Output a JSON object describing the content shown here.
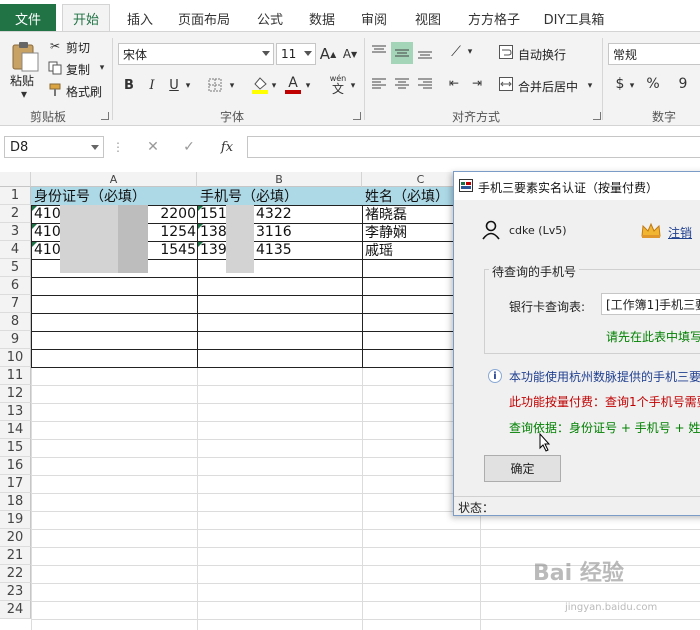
{
  "tabs": {
    "file": "文件",
    "items": [
      "开始",
      "插入",
      "页面布局",
      "公式",
      "数据",
      "审阅",
      "视图",
      "方方格子",
      "DIY工具箱"
    ]
  },
  "ribbon": {
    "clipboard": {
      "paste": "粘贴",
      "cut": "剪切",
      "copy": "复制",
      "format_painter": "格式刷",
      "label": "剪贴板"
    },
    "font": {
      "name": "宋体",
      "size": "11",
      "bold": "B",
      "italic": "I",
      "underline": "U",
      "label": "字体",
      "wen": "wén",
      "grow": "A",
      "shrink": "A",
      "phonetic_char": "文"
    },
    "alignment": {
      "wrap": "自动换行",
      "merge": "合并后居中",
      "label": "对齐方式"
    },
    "number": {
      "format": "常规",
      "currency": "$",
      "percent": "%",
      "comma": "9",
      "label": "数字"
    }
  },
  "formula_bar": {
    "name_box": "D8",
    "fx": "fx",
    "value": ""
  },
  "sheet": {
    "columns": [
      "A",
      "B",
      "C"
    ],
    "rows": [
      "1",
      "2",
      "3",
      "4",
      "5",
      "6",
      "7",
      "8",
      "9",
      "10",
      "11",
      "12",
      "13",
      "14",
      "15",
      "16",
      "17",
      "18",
      "19",
      "20",
      "21",
      "22",
      "23",
      "24"
    ],
    "header": [
      "身份证号（必填）",
      "手机号（必填）",
      "姓名（必填）"
    ],
    "data": [
      {
        "id_start": "410",
        "id_end": "2200",
        "phone_start": "151",
        "phone_end": "4322",
        "name": "褚晓磊"
      },
      {
        "id_start": "410",
        "id_end": "1254",
        "phone_start": "138",
        "phone_end": "3116",
        "name": "李静娴"
      },
      {
        "id_start": "410",
        "id_end": "1545",
        "phone_start": "139",
        "phone_end": "4135",
        "name": "戚瑶"
      }
    ]
  },
  "dialog": {
    "title": "手机三要素实名认证（按量付费）",
    "user": "cdke (Lv5)",
    "logout": "注销",
    "group_title": "待查询的手机号",
    "table_label": "银行卡查询表:",
    "table_value": "[工作簿1]手机三要",
    "hint_green": "请先在此表中填写",
    "info_blue": "本功能使用杭州数脉提供的手机三要",
    "info_red": "此功能按量付费：查询1个手机号需要",
    "info_green": "查询依据：身份证号 + 手机号 + 姓",
    "confirm": "确定",
    "status": "状态："
  },
  "colors": {
    "excel_green": "#217346",
    "header_fill": "#add8e6",
    "red": "#c00000",
    "green": "#008000",
    "blue": "#1f3f8f"
  },
  "watermark": {
    "main": "Bai 经验",
    "sub": "jingyan.baidu.com"
  }
}
